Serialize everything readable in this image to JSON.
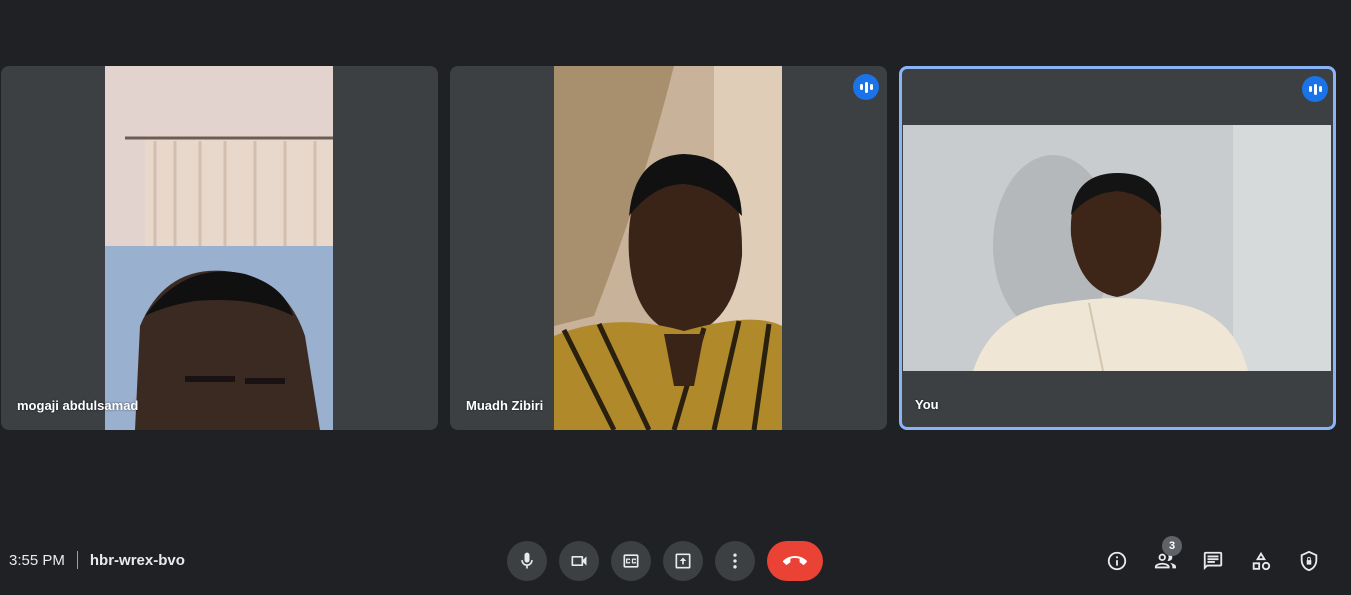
{
  "participants": [
    {
      "name": "mogaji abdulsamad",
      "speaking": false
    },
    {
      "name": "Muadh Zibiri",
      "speaking": true
    },
    {
      "name": "You",
      "speaking": true
    }
  ],
  "meeting": {
    "time": "3:55 PM",
    "code": "hbr-wrex-bvo"
  },
  "controls": [
    "mic-icon",
    "camera-icon",
    "captions-icon",
    "present-icon",
    "more-options-icon",
    "end-call-icon"
  ],
  "side_panel": {
    "people_count": "3",
    "icons": [
      "info-icon",
      "people-icon",
      "chat-icon",
      "activities-icon",
      "host-controls-icon"
    ]
  },
  "colors": {
    "background": "#202124",
    "tile": "#3c4043",
    "active_border": "#8ab4f8",
    "speaking": "#1a73e8",
    "end_call": "#ea4335"
  }
}
